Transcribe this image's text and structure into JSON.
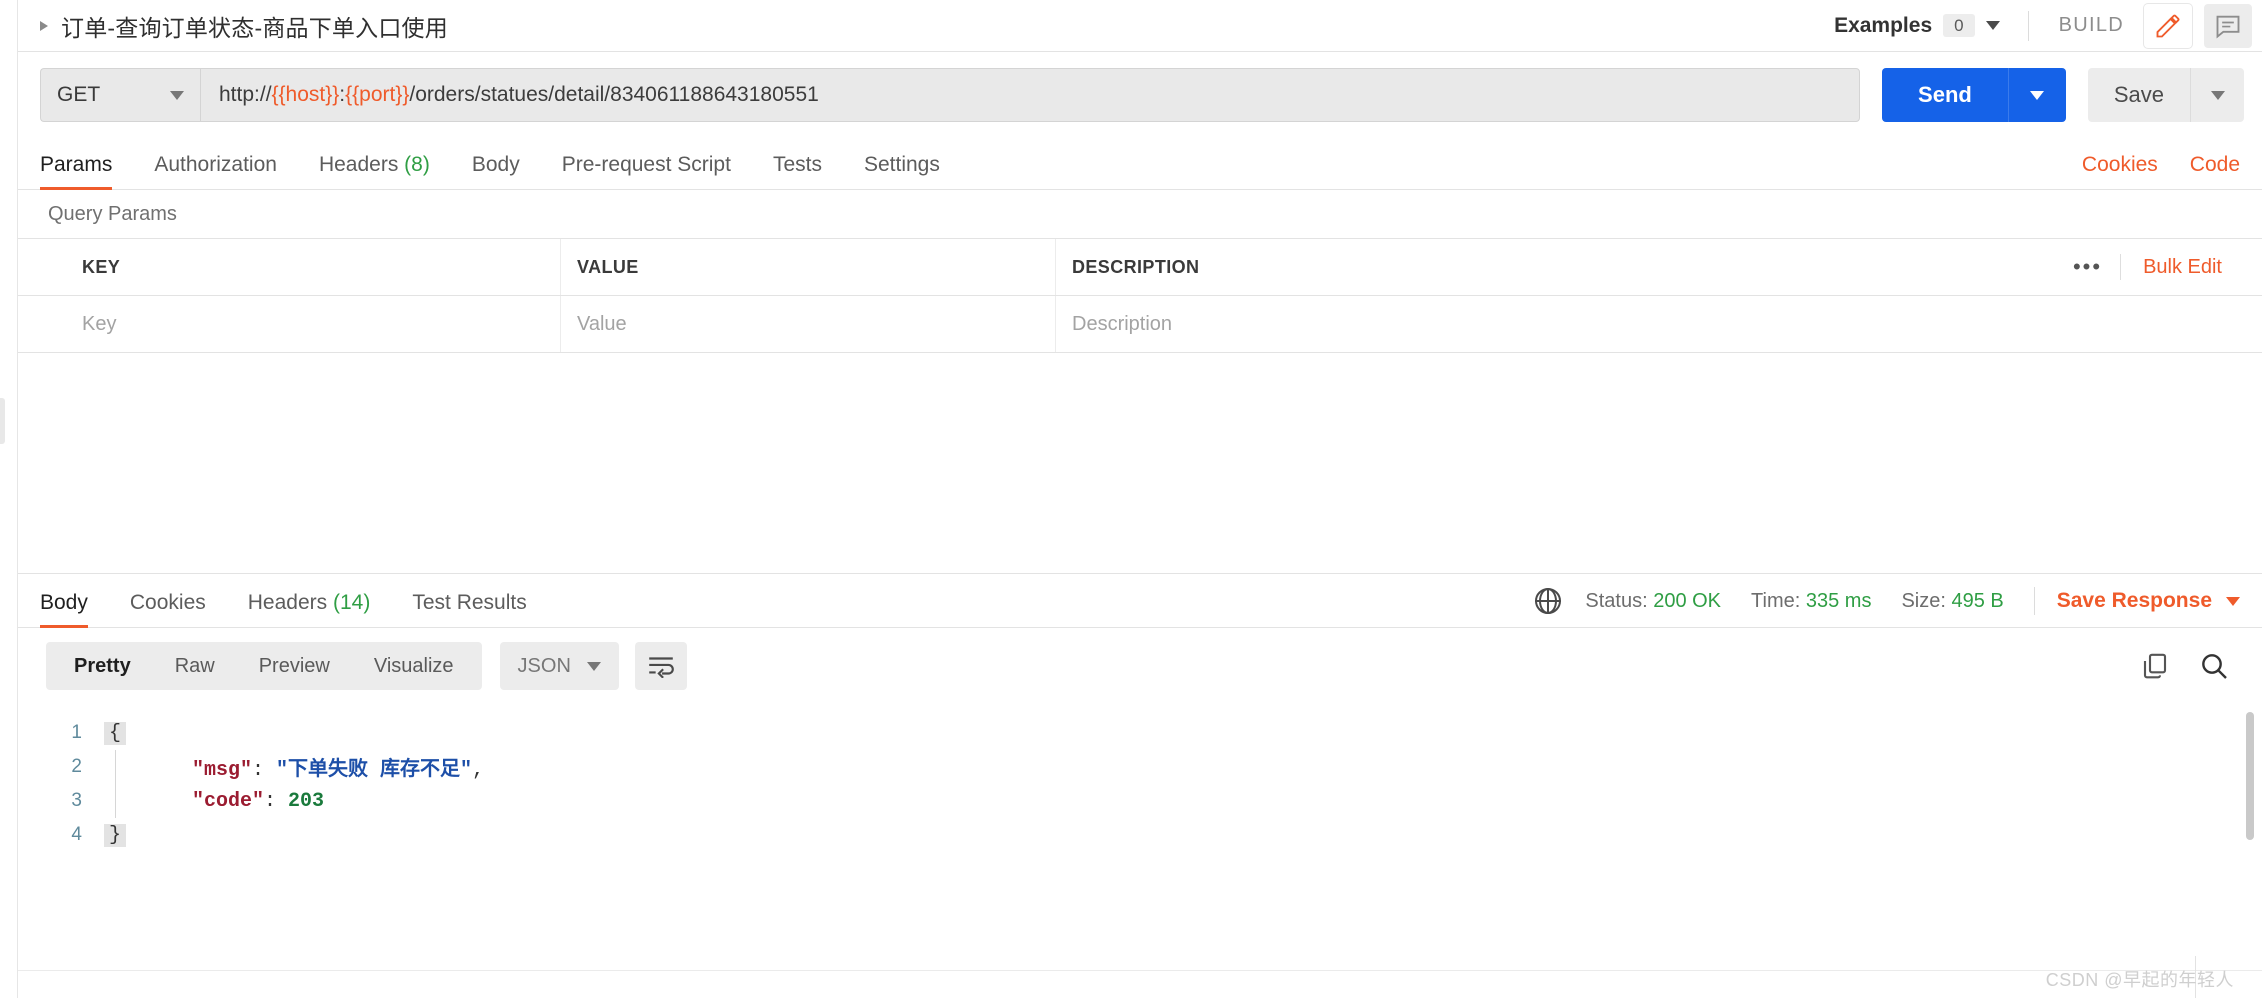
{
  "header": {
    "title": "订单-查询订单状态-商品下单入口使用",
    "expand_icon": "caret-right-icon",
    "examples_label": "Examples",
    "examples_count": "0",
    "build_label": "BUILD",
    "edit_icon": "pencil-icon",
    "comment_icon": "comment-icon",
    "accent_orange": "#ef5b2b"
  },
  "request": {
    "method": "GET",
    "url_prefix": "http://",
    "url_var_host": "{{host}}",
    "url_colon": ":",
    "url_var_port": "{{port}}",
    "url_path": "/orders/statues/detail/834061188643180551",
    "send_label": "Send",
    "save_label": "Save",
    "send_color": "#1562e8"
  },
  "request_tabs": [
    {
      "label": "Params",
      "count": "",
      "active": true
    },
    {
      "label": "Authorization",
      "count": "",
      "active": false
    },
    {
      "label": "Headers",
      "count": "(8)",
      "active": false
    },
    {
      "label": "Body",
      "count": "",
      "active": false
    },
    {
      "label": "Pre-request Script",
      "count": "",
      "active": false
    },
    {
      "label": "Tests",
      "count": "",
      "active": false
    },
    {
      "label": "Settings",
      "count": "",
      "active": false
    }
  ],
  "request_tabs_right": {
    "cookies": "Cookies",
    "code": "Code"
  },
  "query_params": {
    "section_title": "Query Params",
    "columns": [
      "KEY",
      "VALUE",
      "DESCRIPTION"
    ],
    "more_icon": "•••",
    "bulk_edit": "Bulk Edit",
    "rows": [
      {
        "key_placeholder": "Key",
        "value_placeholder": "Value",
        "desc_placeholder": "Description"
      }
    ]
  },
  "response_tabs": [
    {
      "label": "Body",
      "count": "",
      "active": true
    },
    {
      "label": "Cookies",
      "count": "",
      "active": false
    },
    {
      "label": "Headers",
      "count": "(14)",
      "active": false
    },
    {
      "label": "Test Results",
      "count": "",
      "active": false
    }
  ],
  "response_status": {
    "globe_icon": "globe-icon",
    "status_label": "Status:",
    "status_value": "200 OK",
    "time_label": "Time:",
    "time_value": "335 ms",
    "size_label": "Size:",
    "size_value": "495 B",
    "save_response": "Save Response",
    "ok_color": "#2f9e44"
  },
  "body_toolbar": {
    "views": [
      {
        "label": "Pretty",
        "active": true
      },
      {
        "label": "Raw",
        "active": false
      },
      {
        "label": "Preview",
        "active": false
      },
      {
        "label": "Visualize",
        "active": false
      }
    ],
    "format": "JSON",
    "wrap_icon": "word-wrap-icon",
    "copy_icon": "copy-icon",
    "search_icon": "search-icon"
  },
  "response_body": {
    "language": "json",
    "lines": [
      {
        "num": "1",
        "fold": "{",
        "indent": "",
        "segments": []
      },
      {
        "num": "2",
        "fold": "",
        "indent": "    ",
        "segments": [
          {
            "t": "\"msg\"",
            "c": "key"
          },
          {
            "t": ": ",
            "c": "punc"
          },
          {
            "t": "\"下单失败 库存不足\"",
            "c": "str"
          },
          {
            "t": ",",
            "c": "punc"
          }
        ]
      },
      {
        "num": "3",
        "fold": "",
        "indent": "    ",
        "segments": [
          {
            "t": "\"code\"",
            "c": "key"
          },
          {
            "t": ": ",
            "c": "punc"
          },
          {
            "t": "203",
            "c": "num"
          }
        ]
      },
      {
        "num": "4",
        "fold": "}",
        "indent": "",
        "segments": []
      }
    ],
    "raw_text": "{\n    \"msg\": \"下单失败 库存不足\",\n    \"code\": 203\n}"
  },
  "watermark": "CSDN @早起的年轻人"
}
